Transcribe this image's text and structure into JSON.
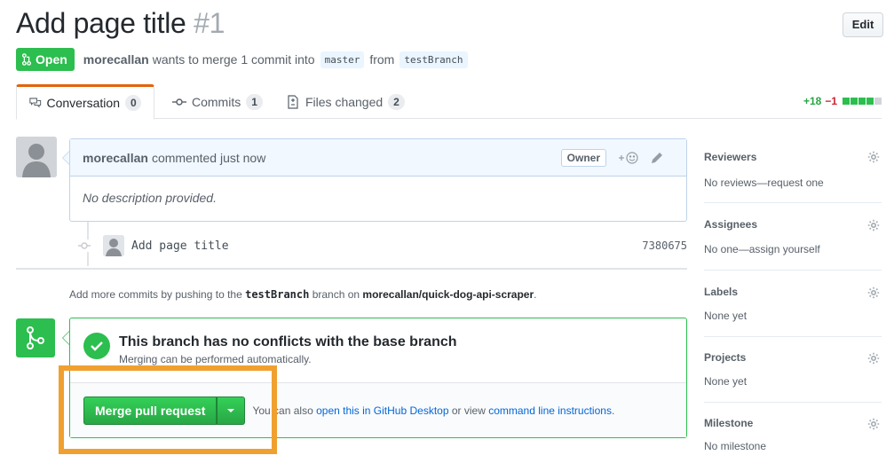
{
  "header": {
    "title": "Add page title",
    "number": "#1",
    "edit_label": "Edit"
  },
  "meta": {
    "state": "Open",
    "author": "morecallan",
    "text_a": "wants to merge 1 commit into",
    "base_branch": "master",
    "text_b": "from",
    "head_branch": "testBranch"
  },
  "tabs": [
    {
      "label": "Conversation",
      "count": "0"
    },
    {
      "label": "Commits",
      "count": "1"
    },
    {
      "label": "Files changed",
      "count": "2"
    }
  ],
  "diffstat": {
    "additions": "+18",
    "deletions": "−1"
  },
  "comment": {
    "author": "morecallan",
    "action": "commented just now",
    "badge": "Owner",
    "body": "No description provided."
  },
  "commit": {
    "message": "Add page title",
    "sha": "7380675"
  },
  "hint": {
    "pre": "Add more commits by pushing to the",
    "branch": "testBranch",
    "mid": "branch on",
    "repo": "morecallan/quick-dog-api-scraper",
    "post": "."
  },
  "merge": {
    "heading": "This branch has no conflicts with the base branch",
    "subtext": "Merging can be performed automatically.",
    "button_label": "Merge pull request",
    "alt_prefix": "You can also",
    "alt_link1": "open this in GitHub Desktop",
    "alt_mid": "or view",
    "alt_link2": "command line instructions",
    "alt_suffix": "."
  },
  "sidebar": [
    {
      "heading": "Reviewers",
      "value": "No reviews—request one"
    },
    {
      "heading": "Assignees",
      "value": "No one—assign yourself"
    },
    {
      "heading": "Labels",
      "value": "None yet"
    },
    {
      "heading": "Projects",
      "value": "None yet"
    },
    {
      "heading": "Milestone",
      "value": "No milestone"
    }
  ],
  "colors": {
    "open_green": "#2cbe4e",
    "highlight_orange": "#f0a030",
    "link_blue": "#0366d6",
    "tab_accent": "#e36209"
  }
}
